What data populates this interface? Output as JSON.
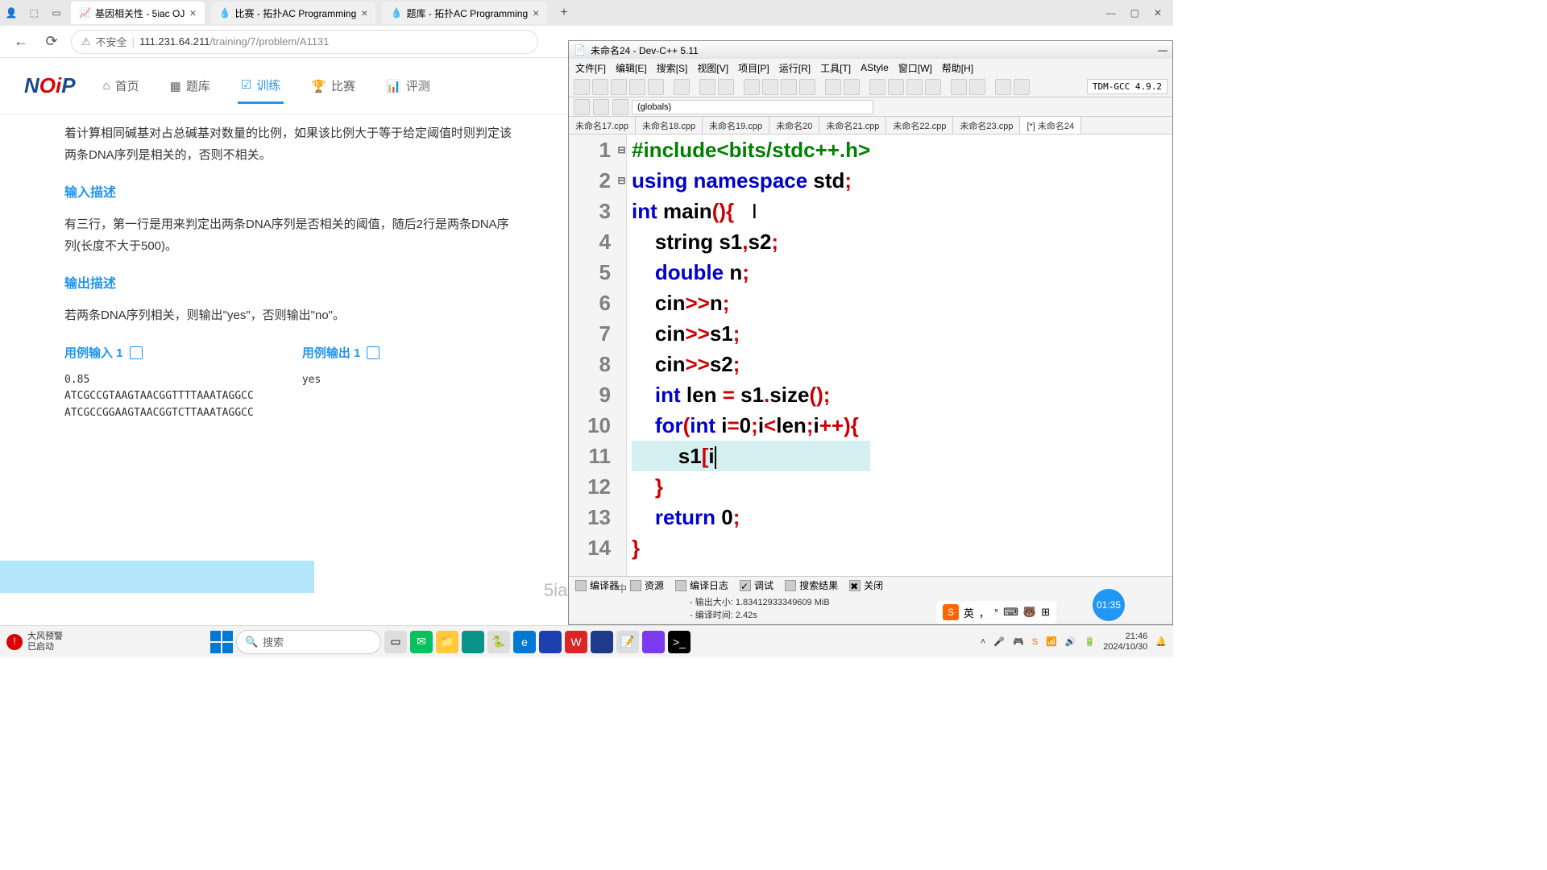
{
  "browser": {
    "tabs": [
      {
        "title": "基因相关性 - 5iac OJ",
        "active": true
      },
      {
        "title": "比赛 - 拓扑AC Programming",
        "active": false
      },
      {
        "title": "题库 - 拓扑AC Programming",
        "active": false
      }
    ],
    "unsafe_label": "不安全",
    "url_host": "111.231.64.211",
    "url_path": "/training/7/problem/A1131"
  },
  "nav": {
    "logo": "NOiP",
    "items": [
      {
        "label": "首页"
      },
      {
        "label": "题库"
      },
      {
        "label": "训练",
        "active": true
      },
      {
        "label": "比赛"
      },
      {
        "label": "评测"
      }
    ]
  },
  "problem": {
    "desc_para": "着计算相同碱基对占总碱基对数量的比例，如果该比例大于等于给定阈值时则判定该两条DNA序列是相关的，否则不相关。",
    "input_title": "输入描述",
    "input_body": "有三行，第一行是用来判定出两条DNA序列是否相关的阈值，随后2行是两条DNA序列(长度不大于500)。",
    "output_title": "输出描述",
    "output_body": "若两条DNA序列相关，则输出\"yes\"，否则输出\"no\"。",
    "example_in_label": "用例输入 1",
    "example_out_label": "用例输出 1",
    "example_in": "0.85\nATCGCCGTAAGTAACGGTTTTAAATAGGCC\nATCGCCGGAAGTAACGGTCTTAAATAGGCC",
    "example_out": "yes",
    "watermark": "5ia"
  },
  "ide": {
    "title": "未命名24 - Dev-C++ 5.11",
    "menus": [
      "文件[F]",
      "编辑[E]",
      "搜索[S]",
      "视图[V]",
      "项目[P]",
      "运行[R]",
      "工具[T]",
      "AStyle",
      "窗口[W]",
      "帮助[H]"
    ],
    "compiler": "TDM-GCC 4.9.2",
    "globals": "(globals)",
    "tabs": [
      "未命名17.cpp",
      "未命名18.cpp",
      "未命名19.cpp",
      "未命名20",
      "未命名21.cpp",
      "未命名22.cpp",
      "未命名23.cpp",
      "[*] 未命名24"
    ],
    "code_lines": [
      {
        "n": 1,
        "tokens": [
          [
            "gr",
            "#include<bits/stdc++.h>"
          ]
        ]
      },
      {
        "n": 2,
        "tokens": [
          [
            "kw",
            "using namespace "
          ],
          [
            "bk",
            "std"
          ],
          [
            "rd",
            ";"
          ]
        ]
      },
      {
        "n": 3,
        "fold": "⊟",
        "tokens": [
          [
            "kw",
            "int "
          ],
          [
            "bk",
            "main"
          ],
          [
            "rd",
            "(){"
          ]
        ]
      },
      {
        "n": 4,
        "tokens": [
          [
            "bk",
            "    string s1"
          ],
          [
            "rd",
            ","
          ],
          [
            "bk",
            "s2"
          ],
          [
            "rd",
            ";"
          ]
        ]
      },
      {
        "n": 5,
        "tokens": [
          [
            "bk",
            "    "
          ],
          [
            "kw",
            "double "
          ],
          [
            "bk",
            "n"
          ],
          [
            "rd",
            ";"
          ]
        ]
      },
      {
        "n": 6,
        "tokens": [
          [
            "bk",
            "    cin"
          ],
          [
            "rd",
            ">>"
          ],
          [
            "bk",
            "n"
          ],
          [
            "rd",
            ";"
          ]
        ]
      },
      {
        "n": 7,
        "tokens": [
          [
            "bk",
            "    cin"
          ],
          [
            "rd",
            ">>"
          ],
          [
            "bk",
            "s1"
          ],
          [
            "rd",
            ";"
          ]
        ]
      },
      {
        "n": 8,
        "tokens": [
          [
            "bk",
            "    cin"
          ],
          [
            "rd",
            ">>"
          ],
          [
            "bk",
            "s2"
          ],
          [
            "rd",
            ";"
          ]
        ]
      },
      {
        "n": 9,
        "tokens": [
          [
            "bk",
            "    "
          ],
          [
            "kw",
            "int "
          ],
          [
            "bk",
            "len "
          ],
          [
            "rd",
            "="
          ],
          [
            "bk",
            " s1"
          ],
          [
            "rd",
            "."
          ],
          [
            "bk",
            "size"
          ],
          [
            "rd",
            "();"
          ]
        ]
      },
      {
        "n": 10,
        "fold": "⊟",
        "tokens": [
          [
            "bk",
            "    "
          ],
          [
            "kw",
            "for"
          ],
          [
            "rd",
            "("
          ],
          [
            "kw",
            "int "
          ],
          [
            "bk",
            "i"
          ],
          [
            "rd",
            "="
          ],
          [
            "bk",
            "0"
          ],
          [
            "rd",
            ";"
          ],
          [
            "bk",
            "i"
          ],
          [
            "rd",
            "<"
          ],
          [
            "bk",
            "len"
          ],
          [
            "rd",
            ";"
          ],
          [
            "bk",
            "i"
          ],
          [
            "rd",
            "++){"
          ]
        ]
      },
      {
        "n": 11,
        "hl": true,
        "tokens": [
          [
            "bk",
            "        s1"
          ],
          [
            "rd",
            "["
          ],
          [
            "bk",
            "i"
          ]
        ]
      },
      {
        "n": 12,
        "tokens": [
          [
            "bk",
            "    "
          ],
          [
            "rd",
            "}"
          ]
        ]
      },
      {
        "n": 13,
        "tokens": [
          [
            "bk",
            "    "
          ],
          [
            "kw",
            "return "
          ],
          [
            "bk",
            "0"
          ],
          [
            "rd",
            ";"
          ]
        ]
      },
      {
        "n": 14,
        "tokens": [
          [
            "rd",
            "}"
          ]
        ]
      }
    ],
    "bottom_tabs": [
      "编译器",
      "资源",
      "编译日志",
      "调试",
      "搜索结果",
      "关闭"
    ],
    "status1_label": "- 输出大小:",
    "status1_value": "1.83412933349609 MiB",
    "status2_label": "- 编译时间:",
    "status2_value": "2.42s",
    "zhong": "中"
  },
  "taskbar": {
    "weather_title": "大风预警",
    "weather_sub": "已启动",
    "search_placeholder": "搜索",
    "time": "21:46",
    "date": "2024/10/30",
    "badge_time": "01:35",
    "ime_lang": "英"
  }
}
